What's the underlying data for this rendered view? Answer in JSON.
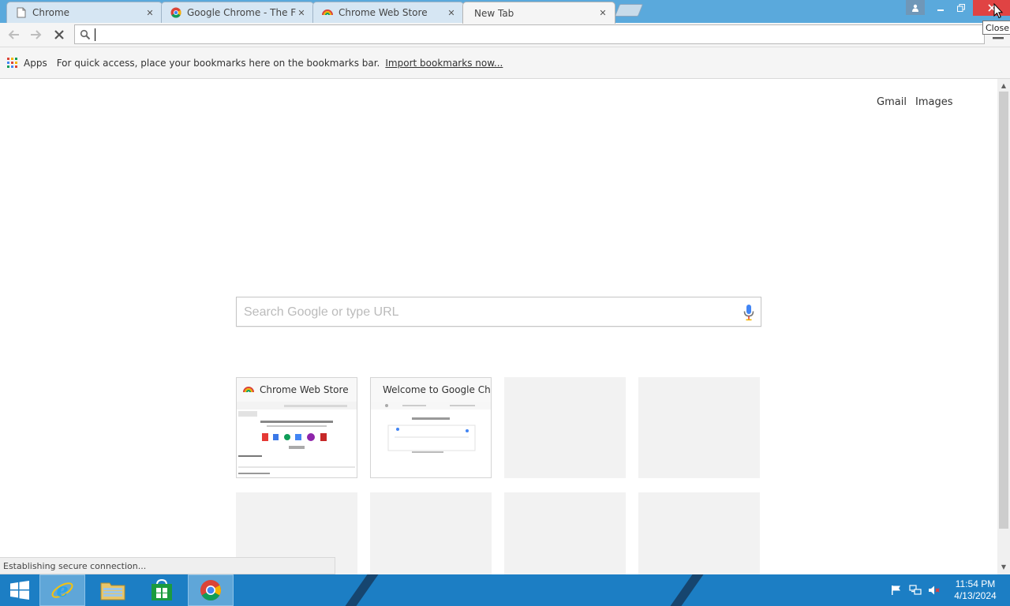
{
  "browser": {
    "tabs": [
      {
        "label": "Chrome",
        "favicon": "page-icon",
        "active": false
      },
      {
        "label": "Google Chrome - The Fast",
        "favicon": "chrome-logo-icon",
        "active": false
      },
      {
        "label": "Chrome Web Store",
        "favicon": "web-store-icon",
        "active": false
      },
      {
        "label": "New Tab",
        "favicon": "",
        "active": true
      }
    ],
    "close_tooltip": "Close"
  },
  "toolbar": {
    "omnibox_value": ""
  },
  "bookmarks": {
    "apps_label": "Apps",
    "hint": "For quick access, place your bookmarks here on the bookmarks bar.",
    "import_link": "Import bookmarks now..."
  },
  "page": {
    "gmail": "Gmail",
    "images": "Images",
    "search_placeholder": "Search Google or type URL",
    "tiles": [
      {
        "title": "Chrome Web Store",
        "favicon": "web-store-icon"
      },
      {
        "title": "Welcome to Google Chrome",
        "favicon": "chrome-logo-icon"
      }
    ]
  },
  "status": {
    "text": "Establishing secure connection..."
  },
  "taskbar": {
    "time": "11:54 PM",
    "date": "4/13/2024"
  },
  "colors": {
    "titlebar": "#5aa9dc",
    "close_button": "#e04343",
    "taskbar": "#1c7ec4"
  }
}
